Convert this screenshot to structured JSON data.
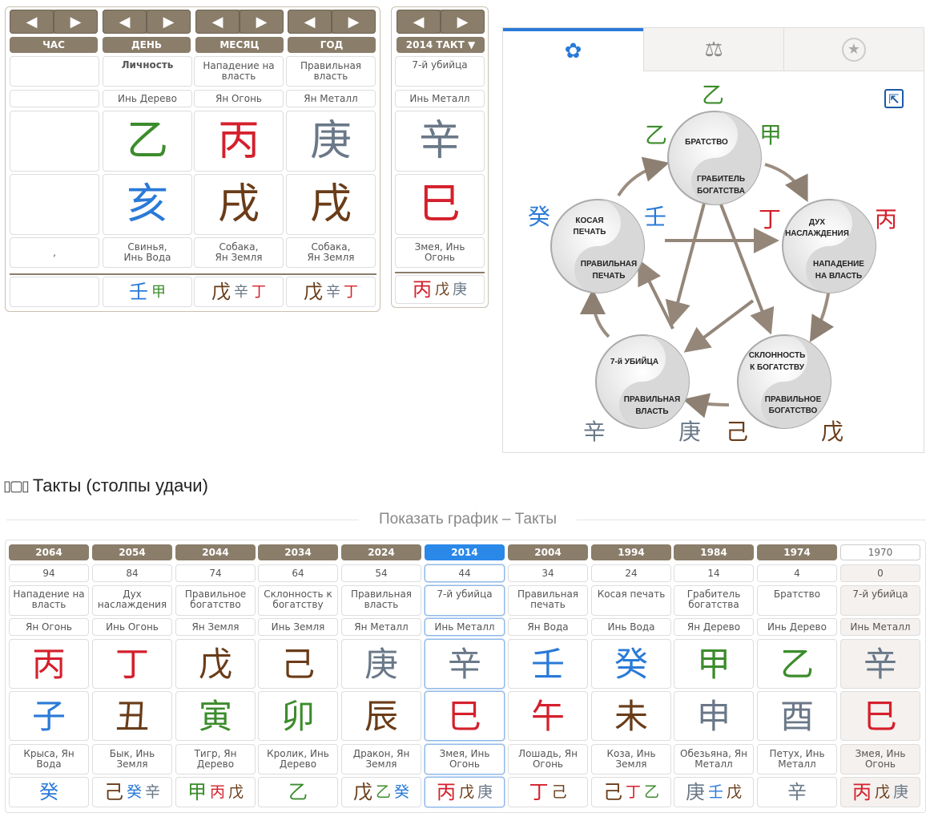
{
  "chart": {
    "nav_left": "◀",
    "nav_right": "▶",
    "headers": {
      "hour": "ЧАС",
      "day": "ДЕНЬ",
      "month": "МЕСЯЦ",
      "year": "ГОД",
      "takt": "2014 ТАКТ ▼"
    },
    "roles": {
      "hour": "",
      "day": "Личность",
      "month": "Нападение на власть",
      "year": "Правильная власть",
      "takt": "7-й убийца"
    },
    "stems_text": {
      "hour": "",
      "day": "Инь Дерево",
      "month": "Ян Огонь",
      "year": "Ян Металл",
      "takt": "Инь Металл"
    },
    "stems": {
      "hour": "",
      "day": "乙",
      "month": "丙",
      "year": "庚",
      "takt": "辛"
    },
    "branches": {
      "hour": "",
      "day": "亥",
      "month": "戌",
      "year": "戌",
      "takt": "巳"
    },
    "animals": {
      "hour": ",",
      "day": "Свинья, Инь Вода",
      "month": "Собака, Ян Земля",
      "year": "Собака, Ян Земля",
      "takt": "Змея, Инь Огонь"
    },
    "hidden": {
      "day": [
        {
          "c": "壬",
          "e": "water"
        },
        {
          "c": "甲",
          "e": "wood"
        }
      ],
      "month": [
        {
          "c": "戊",
          "e": "earth"
        },
        {
          "c": "辛",
          "e": "metal"
        },
        {
          "c": "丁",
          "e": "fire"
        }
      ],
      "year": [
        {
          "c": "戊",
          "e": "earth"
        },
        {
          "c": "辛",
          "e": "metal"
        },
        {
          "c": "丁",
          "e": "fire"
        }
      ],
      "takt": [
        {
          "c": "丙",
          "e": "fire"
        },
        {
          "c": "戊",
          "e": "earth"
        },
        {
          "c": "庚",
          "e": "metal"
        }
      ]
    }
  },
  "diagram": {
    "tabs": [
      "star-icon",
      "scales-icon",
      "pentagram-icon"
    ],
    "top_stem": "乙",
    "nodes": {
      "top": {
        "upper": "БРАТСТВО",
        "lower": "ГРАБИТЕЛЬ БОГАТСТВА",
        "left": "乙",
        "right": "甲"
      },
      "right": {
        "upper": "ДУХ НАСЛАЖДЕНИЯ",
        "lower": "НАПАДЕНИЕ НА ВЛАСТЬ",
        "left": "丁",
        "right": "丙"
      },
      "bottom_right": {
        "upper": "СКЛОННОСТЬ К БОГАТСТВУ",
        "lower": "ПРАВИЛЬНОЕ БОГАТСТВО",
        "left": "己",
        "right": "戊"
      },
      "bottom_left": {
        "upper": "7-й УБИЙЦА",
        "lower": "ПРАВИЛЬНАЯ ВЛАСТЬ",
        "left": "辛",
        "right": "庚"
      },
      "left": {
        "upper": "КОСАЯ ПЕЧАТЬ",
        "lower": "ПРАВИЛЬНАЯ ПЕЧАТЬ",
        "left": "癸",
        "right": "壬"
      }
    }
  },
  "section_title": "Такты (столпы удачи)",
  "graph_link": "Показать график – Такты",
  "pillars": [
    {
      "year": "2064",
      "age": "94",
      "role": "Нападение на власть",
      "stem_text": "Ян Огонь",
      "stem": "丙",
      "se": "fire",
      "branch": "子",
      "be": "water",
      "animal": "Крыса, Ян Вода",
      "hidden": [
        {
          "c": "癸",
          "e": "water"
        }
      ]
    },
    {
      "year": "2054",
      "age": "84",
      "role": "Дух наслаждения",
      "stem_text": "Инь Огонь",
      "stem": "丁",
      "se": "fire",
      "branch": "丑",
      "be": "earth",
      "animal": "Бык, Инь Земля",
      "hidden": [
        {
          "c": "己",
          "e": "earth"
        },
        {
          "c": "癸",
          "e": "water"
        },
        {
          "c": "辛",
          "e": "metal"
        }
      ]
    },
    {
      "year": "2044",
      "age": "74",
      "role": "Правильное богатство",
      "stem_text": "Ян Земля",
      "stem": "戊",
      "se": "earth",
      "branch": "寅",
      "be": "wood",
      "animal": "Тигр, Ян Дерево",
      "hidden": [
        {
          "c": "甲",
          "e": "wood"
        },
        {
          "c": "丙",
          "e": "fire"
        },
        {
          "c": "戊",
          "e": "earth"
        }
      ]
    },
    {
      "year": "2034",
      "age": "64",
      "role": "Склонность к богатству",
      "stem_text": "Инь Земля",
      "stem": "己",
      "se": "earth",
      "branch": "卯",
      "be": "wood",
      "animal": "Кролик, Инь Дерево",
      "hidden": [
        {
          "c": "乙",
          "e": "wood"
        }
      ]
    },
    {
      "year": "2024",
      "age": "54",
      "role": "Правильная власть",
      "stem_text": "Ян Металл",
      "stem": "庚",
      "se": "metal",
      "branch": "辰",
      "be": "earth",
      "animal": "Дракон, Ян Земля",
      "hidden": [
        {
          "c": "戊",
          "e": "earth"
        },
        {
          "c": "乙",
          "e": "wood"
        },
        {
          "c": "癸",
          "e": "water"
        }
      ]
    },
    {
      "year": "2014",
      "age": "44",
      "role": "7-й убийца",
      "stem_text": "Инь Металл",
      "stem": "辛",
      "se": "metal",
      "branch": "巳",
      "be": "fire",
      "animal": "Змея, Инь Огонь",
      "hidden": [
        {
          "c": "丙",
          "e": "fire"
        },
        {
          "c": "戊",
          "e": "earth"
        },
        {
          "c": "庚",
          "e": "metal"
        }
      ],
      "selected": true
    },
    {
      "year": "2004",
      "age": "34",
      "role": "Правильная печать",
      "stem_text": "Ян Вода",
      "stem": "壬",
      "se": "water",
      "branch": "午",
      "be": "fire",
      "animal": "Лошадь, Ян Огонь",
      "hidden": [
        {
          "c": "丁",
          "e": "fire"
        },
        {
          "c": "己",
          "e": "earth"
        }
      ]
    },
    {
      "year": "1994",
      "age": "24",
      "role": "Косая печать",
      "stem_text": "Инь Вода",
      "stem": "癸",
      "se": "water",
      "branch": "未",
      "be": "earth",
      "animal": "Коза, Инь Земля",
      "hidden": [
        {
          "c": "己",
          "e": "earth"
        },
        {
          "c": "丁",
          "e": "fire"
        },
        {
          "c": "乙",
          "e": "wood"
        }
      ]
    },
    {
      "year": "1984",
      "age": "14",
      "role": "Грабитель богатства",
      "stem_text": "Ян Дерево",
      "stem": "甲",
      "se": "wood",
      "branch": "申",
      "be": "metal",
      "animal": "Обезьяна, Ян Металл",
      "hidden": [
        {
          "c": "庚",
          "e": "metal"
        },
        {
          "c": "壬",
          "e": "water"
        },
        {
          "c": "戊",
          "e": "earth"
        }
      ]
    },
    {
      "year": "1974",
      "age": "4",
      "role": "Братство",
      "stem_text": "Инь Дерево",
      "stem": "乙",
      "se": "wood",
      "branch": "酉",
      "be": "metal",
      "animal": "Петух, Инь Металл",
      "hidden": [
        {
          "c": "辛",
          "e": "metal"
        }
      ]
    },
    {
      "year": "1970",
      "age": "0",
      "role": "7-й убийца",
      "stem_text": "Инь Металл",
      "stem": "辛",
      "se": "metal",
      "branch": "巳",
      "be": "fire",
      "animal": "Змея, Инь Огонь",
      "hidden": [
        {
          "c": "丙",
          "e": "fire"
        },
        {
          "c": "戊",
          "e": "earth"
        },
        {
          "c": "庚",
          "e": "metal"
        }
      ],
      "gray": true
    }
  ],
  "colors": {
    "header_brown": "#8a7d6a",
    "selected_blue": "#2a88e8",
    "wood": "#3c8c2c",
    "fire": "#d4202c",
    "earth": "#6a3c18",
    "metal": "#6a7888",
    "water": "#2a7ad8"
  }
}
